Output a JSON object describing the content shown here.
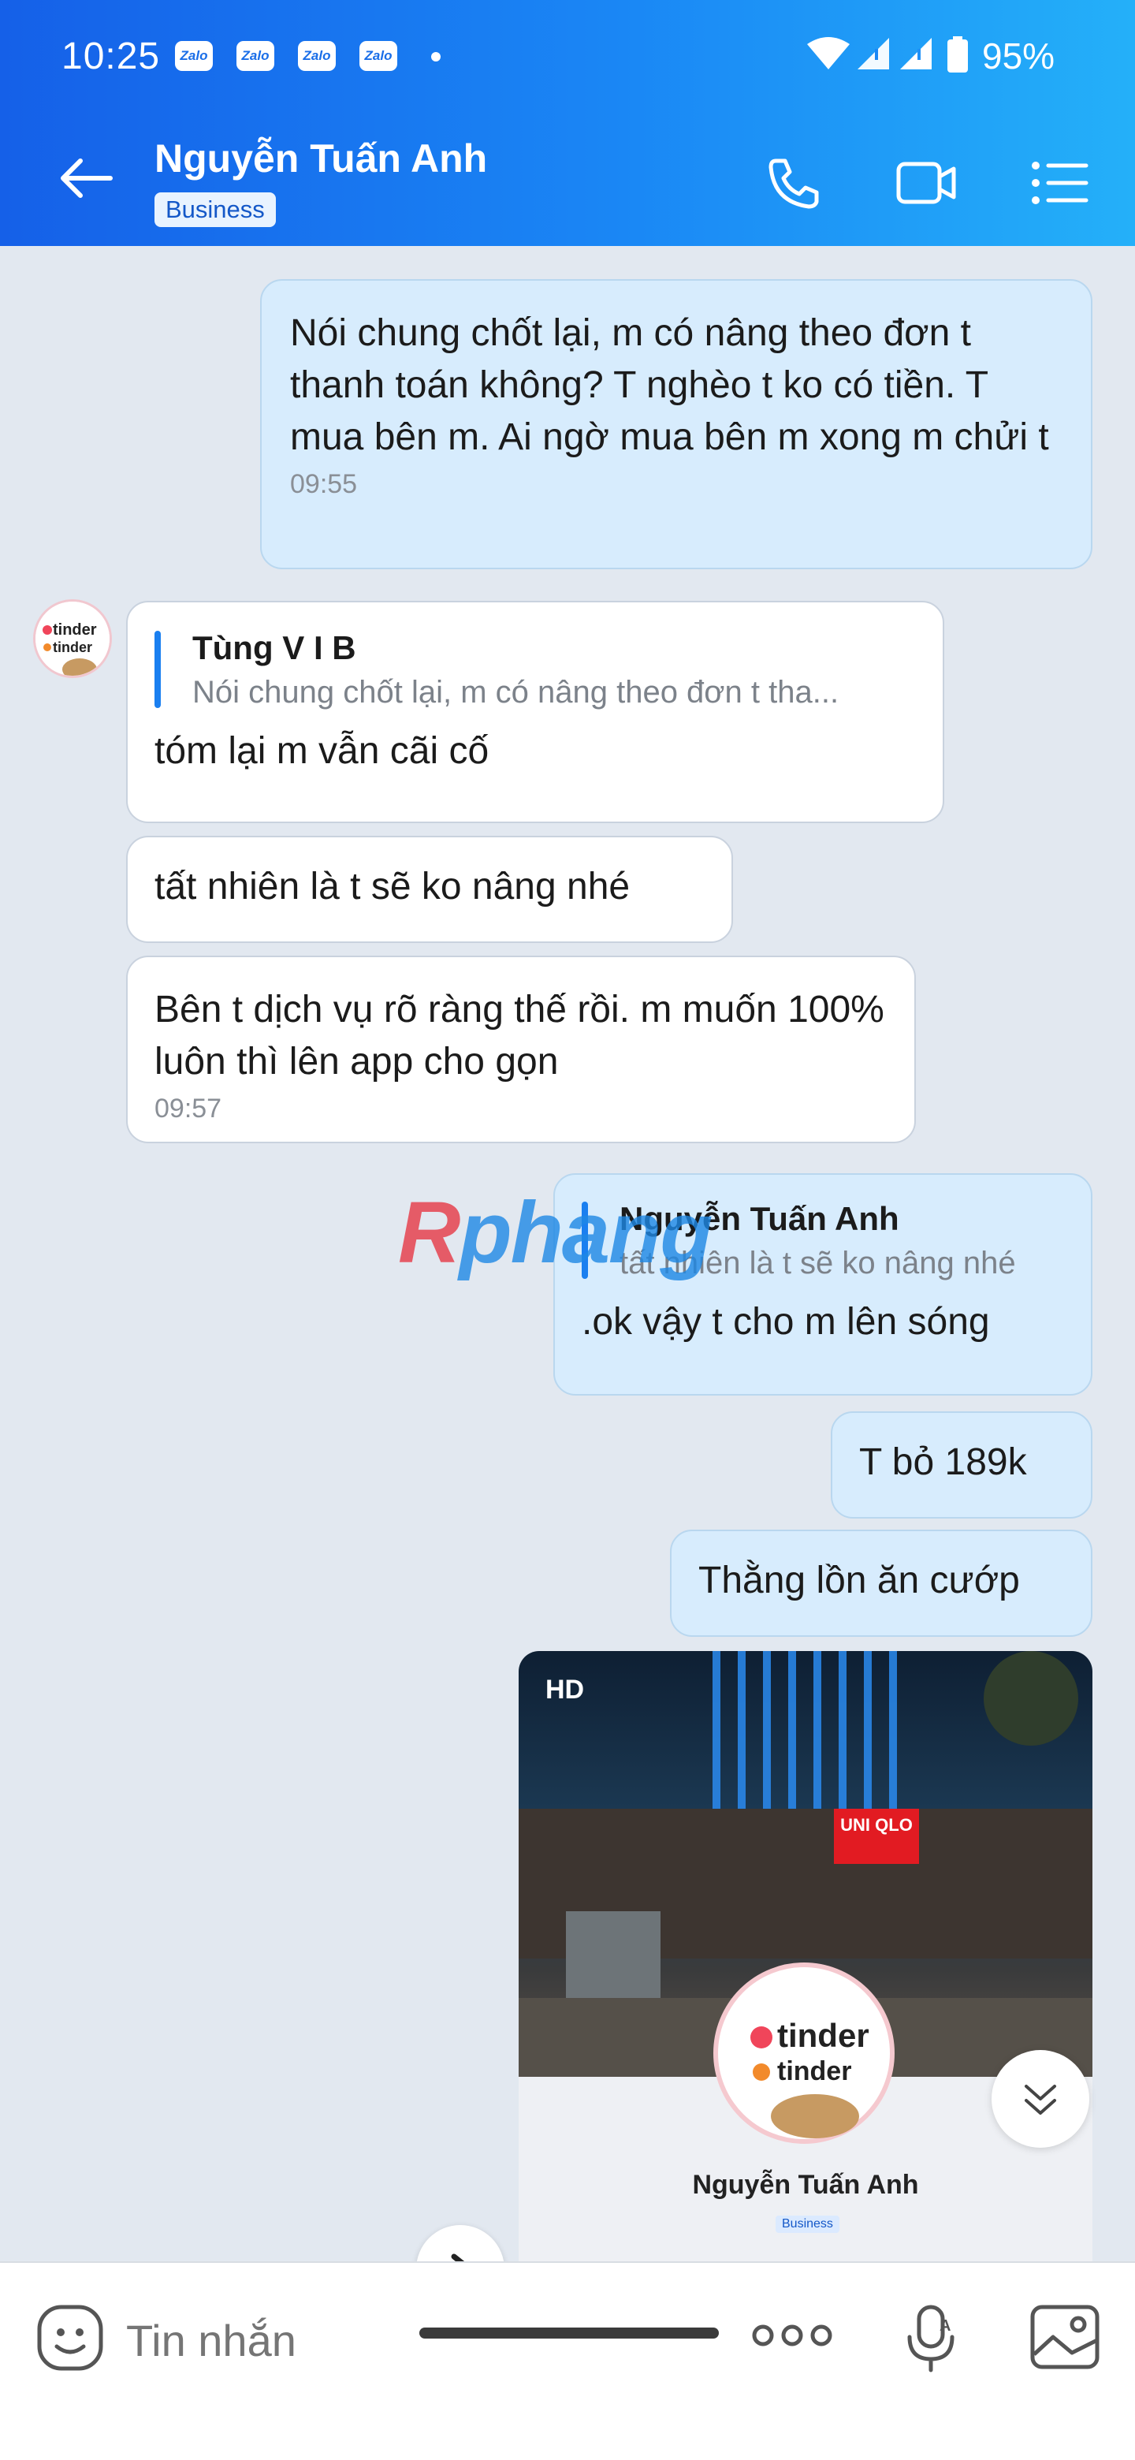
{
  "status_bar": {
    "time": "10:25",
    "notifications": [
      "Zalo",
      "Zalo",
      "Zalo",
      "Zalo"
    ],
    "battery": "95%",
    "icons": [
      "wifi-icon",
      "signal-icon",
      "signal-icon",
      "battery-icon"
    ]
  },
  "header": {
    "contact_name": "Nguyễn Tuấn Anh",
    "badge": "Business",
    "icons": [
      "back-arrow-icon",
      "phone-icon",
      "video-call-icon",
      "menu-list-icon"
    ]
  },
  "messages": [
    {
      "id": "m1",
      "side": "me",
      "text": "Nói chung chốt lại, m có nâng theo đơn t thanh toán không? T nghèo t ko có tiền. T mua bên m. Ai ngờ mua bên m xong m chửi t",
      "time": "09:55"
    },
    {
      "id": "m2",
      "side": "them",
      "quote_name": "Tùng V I B",
      "quote_text": "Nói chung chốt lại, m có nâng theo đơn t tha...",
      "text": "tóm lại m vẫn cãi cố"
    },
    {
      "id": "m3",
      "side": "them",
      "text": "tất nhiên là t sẽ ko nâng nhé"
    },
    {
      "id": "m4",
      "side": "them",
      "text": "Bên t dịch vụ rõ ràng thế rồi. m muốn 100% luôn thì lên app cho gọn",
      "time": "09:57"
    },
    {
      "id": "m5",
      "side": "me",
      "quote_name": "Nguyễn Tuấn Anh",
      "quote_text": "tất nhiên là t sẽ ko nâng nhé",
      "text": ".ok vậy t cho m lên sóng"
    },
    {
      "id": "m6",
      "side": "me",
      "text": "T bỏ 189k"
    },
    {
      "id": "m7",
      "side": "me",
      "text": "Thằng lồn ăn cướp"
    }
  ],
  "watermark": {
    "r": "R",
    "rest": "phang"
  },
  "image_message": {
    "hd_label": "HD",
    "store_sign": "UNI QLO",
    "profile_name": "Nguyễn Tuấn Anh",
    "profile_badge": "Business",
    "avatar_text": [
      "tinder",
      "tinder"
    ]
  },
  "input": {
    "placeholder": "Tin nhắn",
    "icons": [
      "emoji-icon",
      "more-icon",
      "voice-text-icon",
      "gallery-icon"
    ]
  },
  "colors": {
    "header_start": "#1560e8",
    "header_end": "#24b0f9",
    "my_bubble": "#d7ecfd",
    "their_bubble": "#ffffff",
    "chat_bg": "#e2e8f0",
    "accent": "#1a7ff0"
  }
}
